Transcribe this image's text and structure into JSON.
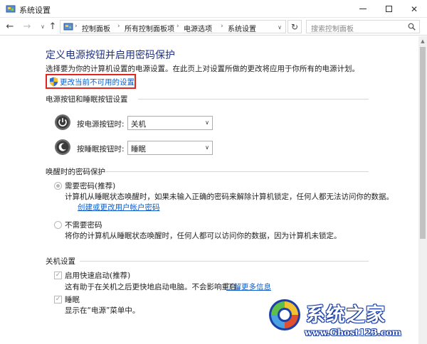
{
  "window": {
    "title": "系统设置",
    "minimize_glyph": "",
    "maximize_glyph": "",
    "close_glyph": "✕"
  },
  "nav": {
    "back_glyph": "←",
    "forward_glyph": "→",
    "recent_glyph": "∨",
    "up_glyph": "↑",
    "breadcrumbs": [
      "控制面板",
      "所有控制面板项",
      "电源选项",
      "系统设置"
    ],
    "separator": "›",
    "dropdown_glyph": "∨",
    "refresh_glyph": "↻",
    "search_placeholder": "搜索控制面板"
  },
  "main": {
    "heading": "定义电源按钮并启用密码保护",
    "intro": "选择要为你的计算机设置的电源设置。在此页上对设置所做的更改将应用于你所有的电源计划。",
    "change_link": "更改当前不可用的设置",
    "power_section": {
      "title": "电源按钮和睡眠按钮设置",
      "rows": [
        {
          "label": "按电源按钮时:",
          "value": "关机"
        },
        {
          "label": "按睡眠按钮时:",
          "value": "睡眠"
        }
      ]
    },
    "wake_section": {
      "title": "唤醒时的密码保护",
      "option_require": {
        "label": "需要密码(推荐)",
        "desc": "计算机从睡眠状态唤醒时，如果未输入正确的密码来解除计算机锁定，任何人都无法访问你的数据。",
        "link": "创建或更改用户帐户密码"
      },
      "option_none": {
        "label": "不需要密码",
        "desc": "将你的计算机从睡眠状态唤醒时，任何人都可以访问你的数据，因为计算机未锁定。"
      }
    },
    "shutdown_section": {
      "title": "关机设置",
      "fast_startup": {
        "label": "启用快速启动(推荐)",
        "desc": "这有助于在关机之后更快地启动电脑。不会影响重启。",
        "link": "了解更多信息"
      },
      "sleep": {
        "label": "睡眠",
        "desc": "显示在“电源”菜单中。"
      }
    },
    "checkmark": "✓",
    "select_arrow": "∨"
  },
  "watermark": {
    "title": "系统之家",
    "url": "www.Ghost123.com"
  },
  "colors": {
    "heading": "#1e3287",
    "link": "#0a5ed1",
    "highlight_box": "#e0241e",
    "watermark": "#1b3fa8"
  }
}
